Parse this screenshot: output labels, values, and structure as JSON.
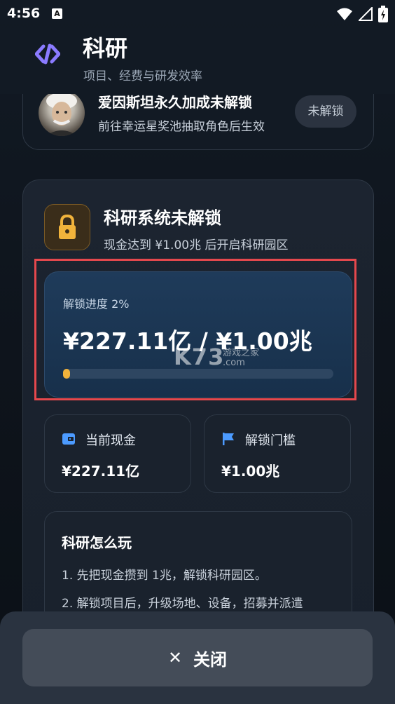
{
  "status": {
    "time": "4:56",
    "notification_letter": "A"
  },
  "header": {
    "title": "科研",
    "subtitle": "项目、经费与研发效率"
  },
  "buff": {
    "title": "爱因斯坦永久加成未解锁",
    "desc": "前往幸运星奖池抽取角色后生效",
    "badge": "未解锁"
  },
  "lock": {
    "title": "科研系统未解锁",
    "desc": "现金达到 ¥1.00兆 后开启科研园区"
  },
  "progress": {
    "label": "解锁进度 2%",
    "value": "¥227.11亿 / ¥1.00兆",
    "percent": 2,
    "color": "#f1b33b"
  },
  "watermark": {
    "big": "K73",
    "small": "游戏之家",
    "domain": ".com"
  },
  "stats": {
    "cash_label": "当前现金",
    "cash_value": "¥227.11亿",
    "threshold_label": "解锁门槛",
    "threshold_value": "¥1.00兆"
  },
  "howto": {
    "title": "科研怎么玩",
    "items": [
      "1. 先把现金攒到 1兆，解锁科研园区。",
      "2. 解锁项目后，升级场地、设备，招募并派遣"
    ]
  },
  "footer": {
    "close_label": "关闭",
    "close_icon": "close-icon"
  },
  "colors": {
    "accent": "#8b7bff",
    "lock": "#f1b33b",
    "highlight": "#e5484d",
    "icon_blue": "#4c9bff"
  }
}
